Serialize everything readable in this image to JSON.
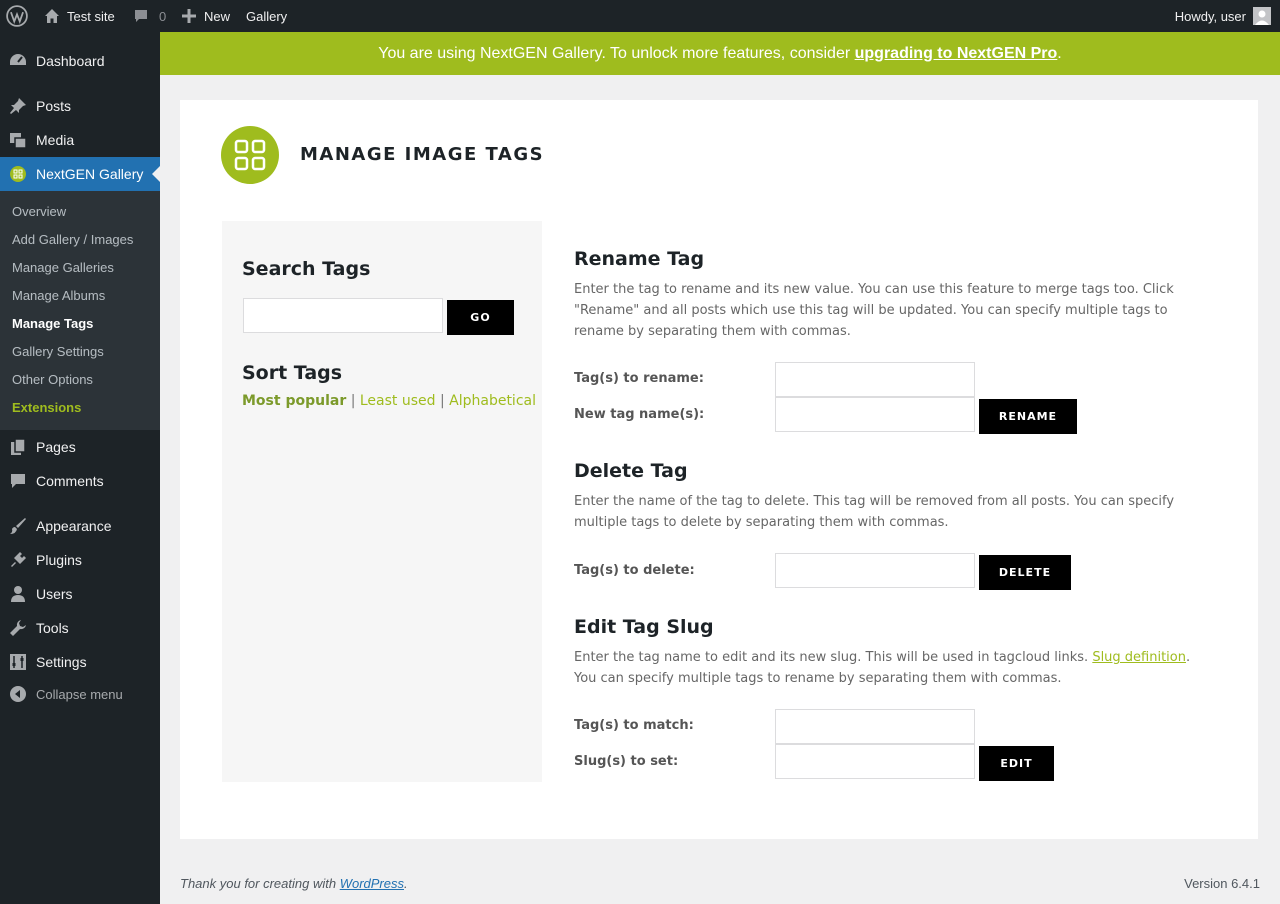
{
  "adminbar": {
    "site_name": "Test site",
    "comments_count": "0",
    "new_label": "New",
    "gallery_label": "Gallery",
    "howdy": "Howdy, user"
  },
  "sidebar": {
    "items": [
      {
        "label": "Dashboard",
        "icon": "dashboard-icon"
      },
      {
        "label": "Posts",
        "icon": "pin-icon"
      },
      {
        "label": "Media",
        "icon": "media-icon"
      },
      {
        "label": "NextGEN Gallery",
        "icon": "nextgen-icon"
      },
      {
        "label": "Pages",
        "icon": "pages-icon"
      },
      {
        "label": "Comments",
        "icon": "comment-icon"
      },
      {
        "label": "Appearance",
        "icon": "brush-icon"
      },
      {
        "label": "Plugins",
        "icon": "plugin-icon"
      },
      {
        "label": "Users",
        "icon": "user-icon"
      },
      {
        "label": "Tools",
        "icon": "wrench-icon"
      },
      {
        "label": "Settings",
        "icon": "settings-icon"
      }
    ],
    "submenu": [
      "Overview",
      "Add Gallery / Images",
      "Manage Galleries",
      "Manage Albums",
      "Manage Tags",
      "Gallery Settings",
      "Other Options",
      "Extensions"
    ],
    "collapse": "Collapse menu"
  },
  "banner": {
    "text": "You are using NextGEN Gallery. To unlock more features, consider ",
    "link": "upgrading to NextGEN Pro",
    "end": "."
  },
  "page": {
    "title": "MANAGE IMAGE TAGS"
  },
  "search": {
    "heading": "Search Tags",
    "value": "",
    "button": "GO"
  },
  "sort": {
    "heading": "Sort Tags",
    "most_popular": "Most popular",
    "least_used": "Least used",
    "alphabetical": "Alphabetical",
    "sep": "|"
  },
  "rename": {
    "heading": "Rename Tag",
    "desc": "Enter the tag to rename and its new value. You can use this feature to merge tags too. Click \"Rename\" and all posts which use this tag will be updated. You can specify multiple tags to rename by separating them with commas.",
    "label_from": "Tag(s) to rename:",
    "label_to": "New tag name(s):",
    "button": "RENAME"
  },
  "delete": {
    "heading": "Delete Tag",
    "desc": "Enter the name of the tag to delete. This tag will be removed from all posts. You can specify multiple tags to delete by separating them with commas.",
    "label": "Tag(s) to delete:",
    "button": "DELETE"
  },
  "slug": {
    "heading": "Edit Tag Slug",
    "desc_before": "Enter the tag name to edit and its new slug. This will be used in tagcloud links. ",
    "desc_link": "Slug definition",
    "desc_after": ". You can specify multiple tags to rename by separating them with commas.",
    "label_match": "Tag(s) to match:",
    "label_set": "Slug(s) to set:",
    "button": "EDIT"
  },
  "footer": {
    "thanks": "Thank you for creating with ",
    "wp_link": "WordPress",
    "end": ".",
    "version": "Version 6.4.1"
  },
  "colors": {
    "accent": "#9fbc1e",
    "sidebar": "#1d2327",
    "current": "#2271b1"
  }
}
